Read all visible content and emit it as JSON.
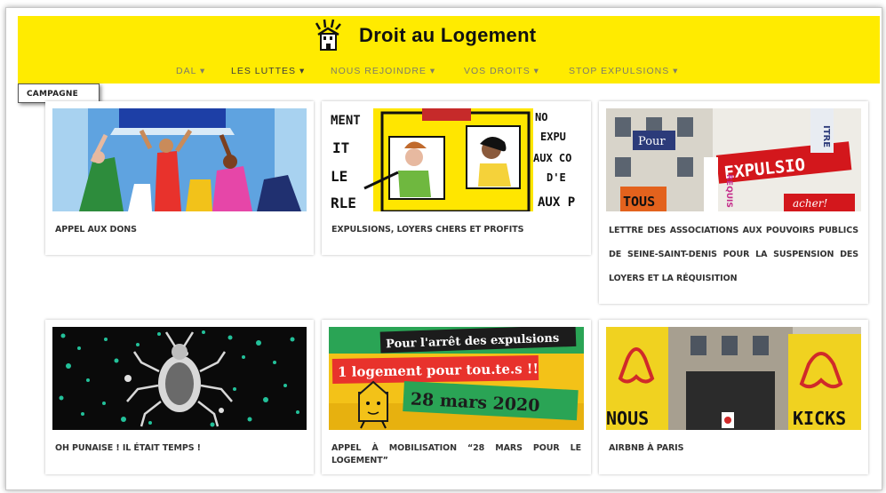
{
  "brand": {
    "name": "Droit au Logement"
  },
  "nav": [
    {
      "label": "DAL"
    },
    {
      "label": "LES LUTTES"
    },
    {
      "label": "NOUS REJOINDRE"
    },
    {
      "label": "VOS DROITS"
    },
    {
      "label": "STOP EXPULSIONS"
    }
  ],
  "campaign": {
    "label": "CAMPAGNE"
  },
  "posts": [
    {
      "title": "APPEL AUX DONS"
    },
    {
      "title": "EXPULSIONS, LOYERS CHERS ET PROFITS"
    },
    {
      "title": "LETTRE DES ASSOCIATIONS AUX POUVOIRS PUBLICS DE SEINE-SAINT-DENIS POUR LA SUSPENSION DES LOYERS ET LA RÉQUISITION"
    },
    {
      "title": "OH PUNAISE ! IL ÉTAIT TEMPS !"
    },
    {
      "title": "APPEL À MOBILISATION “28 MARS POUR LE LOGEMENT”"
    },
    {
      "title": "AIRBNB À PARIS"
    }
  ],
  "images": {
    "comic_words": [
      "MENT",
      "IT",
      "LE",
      "RLE"
    ],
    "comic_words_right": [
      "NO",
      "EXPU",
      "AUX CO",
      "D'E",
      "AUX P"
    ],
    "banner_words": [
      "Pour",
      "EXPULSIO",
      "TOUS",
      "ITRE",
      "REQUIS",
      "acher!"
    ],
    "poster_lines": [
      "Pour l'arrêt des expulsions",
      "1 logement pour tou.te.s !!",
      "28 mars 2020"
    ],
    "flag_words": [
      "NOUS",
      "KICKS"
    ]
  },
  "colors": {
    "header_bg": "#ffeb00",
    "nav_text": "#7d7b6a",
    "title_text": "#333333"
  }
}
